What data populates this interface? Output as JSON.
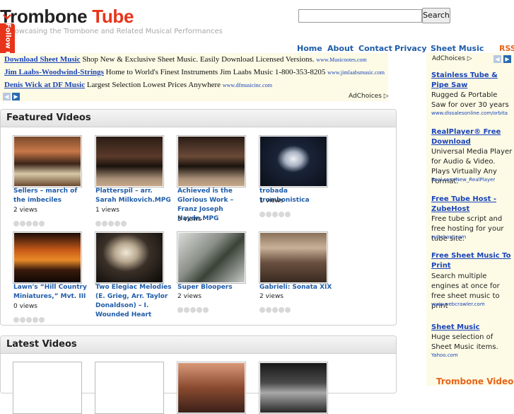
{
  "site": {
    "title_part1": "Trombone ",
    "title_part2": "Tube",
    "tagline": "Showcasing the Trombone and Related Musical Performances",
    "follow_label": "Follow me"
  },
  "search": {
    "placeholder": "",
    "value": "",
    "button_label": "Search"
  },
  "nav": [
    "Home",
    "About",
    "Contact",
    "Privacy",
    "Sheet Music",
    "RSS"
  ],
  "ads_top": {
    "items": [
      {
        "link": "Download Sheet Music",
        "text": " Shop New & Exclusive Sheet Music. Easily Download Licensed Versions. ",
        "url": "www.Musicnotes.com"
      },
      {
        "link": "Jim Laabs-Woodwind-Strings",
        "text": " Home to World's Finest Instruments Jim Laabs Music 1-800-353-8205 ",
        "url": "www.jimlaabsmusic.com"
      },
      {
        "link": "Denis Wick at DF Music",
        "text": " Largest Selection Lowest Prices Anywhere ",
        "url": "www.dfmusicinc.com"
      }
    ],
    "adchoices": "AdChoices",
    "prev_arrow": "◀",
    "next_arrow": "▶"
  },
  "featured": {
    "title": "Featured Videos",
    "videos": [
      {
        "title": "Sellers – march of the imbeciles",
        "views": "2 views",
        "rating": 0
      },
      {
        "title": "Platterspil – arr. Sarah Milkovich.MPG",
        "views": "1 views",
        "rating": 0
      },
      {
        "title": "Achieved is the Glorious Work – Franz Joseph Haydn.MPG",
        "views": "5 views",
        "rating": 0
      },
      {
        "title": "trobada trombonistica",
        "views": "1 views",
        "rating": 0
      },
      {
        "title": "Lawn's “Hill Country Miniatures,” Mvt. III",
        "views": "0 views",
        "rating": 0
      },
      {
        "title": "Two Elegiac Melodies (E. Grieg, Arr. Taylor Donaldson) – I. Wounded Heart",
        "views": "",
        "rating": 0
      },
      {
        "title": "Super Bloopers",
        "views": "2 views",
        "rating": 0
      },
      {
        "title": "Gabrieli: Sonata XIX",
        "views": "2 views",
        "rating": 0
      }
    ]
  },
  "latest": {
    "title": "Latest Videos"
  },
  "sidebar_ads": {
    "adchoices": "AdChoices",
    "prev_arrow": "◀",
    "next_arrow": "▶",
    "items": [
      {
        "title": "Stainless Tube & Pipe Saw",
        "desc": "Rugged & Portable Saw for over 30 years",
        "url": "www.dissalesonline.com/orbita"
      },
      {
        "title": "RealPlayer® Free Download",
        "desc": "Universal Media Player for Audio & Video. Plays Virtually Any Format.",
        "url": "Real.com/New_RealPlayer"
      },
      {
        "title": "Free Tube Host - ZubeHost",
        "desc": "Free tube script and free hosting for your tube site.",
        "url": "zubehost.com"
      },
      {
        "title": "Free Sheet Music To Print",
        "desc": "Search multiple engines at once for free sheet music to print",
        "url": "www.webcrawler.com"
      },
      {
        "title": "Sheet Music",
        "desc": "Huge selection of Sheet Music items.",
        "url": "Yahoo.com"
      }
    ],
    "footer": "Trombone Videos"
  },
  "colors": {
    "accent": "#e8341a",
    "link": "#1e5ca8",
    "ad_bg": "#fdfbe6",
    "rss": "#e8641a"
  },
  "icons": {
    "follow": "chevron-down-icon",
    "arrow_prev": "arrow-left-icon",
    "arrow_next": "arrow-right-icon",
    "adchoices": "adchoices-icon"
  }
}
